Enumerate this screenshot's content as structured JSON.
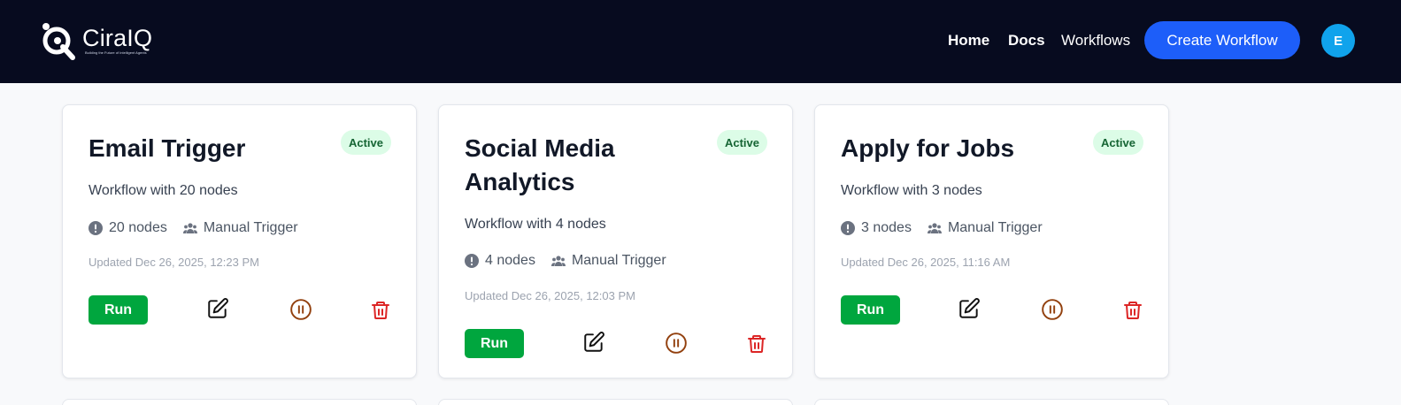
{
  "brand": {
    "name": "CiraIQ",
    "tagline": "Building the Future of Intelligent Agents"
  },
  "nav": {
    "home": "Home",
    "docs": "Docs",
    "workflows": "Workflows",
    "create_label": "Create Workflow",
    "avatar_initial": "E"
  },
  "colors": {
    "nav_bg": "#070b1f",
    "primary": "#1d5ef9",
    "run": "#00a63e",
    "badge_bg": "#dcfce7",
    "badge_fg": "#166534",
    "pause": "#92400e",
    "delete": "#dc2626"
  },
  "workflows": [
    {
      "title": "Email Trigger",
      "status": "Active",
      "description": "Workflow with 20 nodes",
      "nodes": "20 nodes",
      "trigger": "Manual Trigger",
      "updated": "Updated Dec 26, 2025, 12:23 PM",
      "run_label": "Run"
    },
    {
      "title": "Social Media Analytics",
      "status": "Active",
      "description": "Workflow with 4 nodes",
      "nodes": "4 nodes",
      "trigger": "Manual Trigger",
      "updated": "Updated Dec 26, 2025, 12:03 PM",
      "run_label": "Run"
    },
    {
      "title": "Apply for Jobs",
      "status": "Active",
      "description": "Workflow with 3 nodes",
      "nodes": "3 nodes",
      "trigger": "Manual Trigger",
      "updated": "Updated Dec 26, 2025, 11:16 AM",
      "run_label": "Run"
    }
  ],
  "icons": {
    "nodes": "alert-circle-icon",
    "trigger": "users-icon",
    "edit": "edit-icon",
    "pause": "pause-circle-icon",
    "delete": "trash-icon"
  }
}
